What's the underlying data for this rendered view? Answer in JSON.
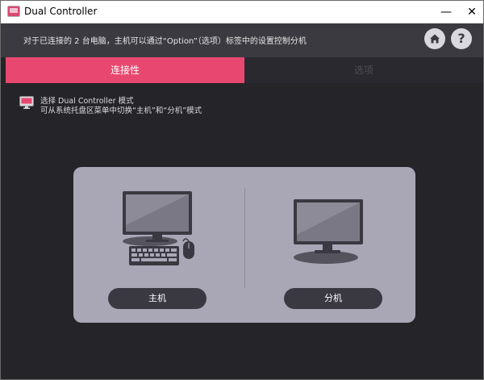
{
  "window": {
    "title": "Dual Controller",
    "minimize_glyph": "—",
    "close_glyph": "✕"
  },
  "infobar": {
    "text": "对于已连接的 2 台电脑，主机可以通过“Option”（选项）标签中的设置控制分机",
    "home_icon": "home-icon",
    "help_label": "?"
  },
  "tabs": [
    {
      "label": "连接性",
      "active": true
    },
    {
      "label": "选项",
      "active": false
    }
  ],
  "mode": {
    "line1": "选择 Dual Controller 模式",
    "line2": "可从系统托盘区菜单中切换“主机”和“分机”模式"
  },
  "choices": {
    "host_label": "主机",
    "client_label": "分机"
  },
  "colors": {
    "accent": "#e8486f",
    "background": "#252429",
    "panel": "#a9a7b6",
    "button": "#3a3942"
  }
}
